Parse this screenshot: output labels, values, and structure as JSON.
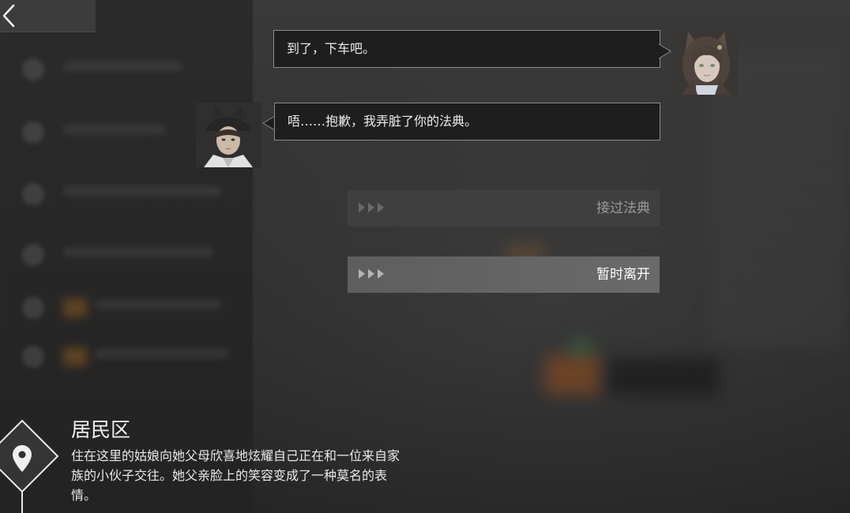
{
  "nav": {
    "back_icon": "chevron-left-icon"
  },
  "dialogue": {
    "lines": [
      {
        "speaker_side": "right",
        "text": "到了，下车吧。"
      },
      {
        "speaker_side": "left",
        "text": "唔……抱歉，我弄脏了你的法典。"
      }
    ]
  },
  "choices": [
    {
      "label": "接过法典",
      "icon": "triple-arrow-icon",
      "state": "dimmed"
    },
    {
      "label": "暂时离开",
      "icon": "triple-arrow-icon",
      "state": "active"
    }
  ],
  "location": {
    "icon": "map-pin-icon",
    "title": "居民区",
    "description": "住在这里的姑娘向她父母欣喜地炫耀自己正在和一位来自家族的小伙子交往。她父亲脸上的笑容变成了一种莫名的表情。"
  },
  "colors": {
    "bubble_bg": "#1e1e1e",
    "bubble_border": "#8a8a8a",
    "choice_dim_bg": "#3f3f3f",
    "choice_active_bg": "#6a6a6a"
  }
}
